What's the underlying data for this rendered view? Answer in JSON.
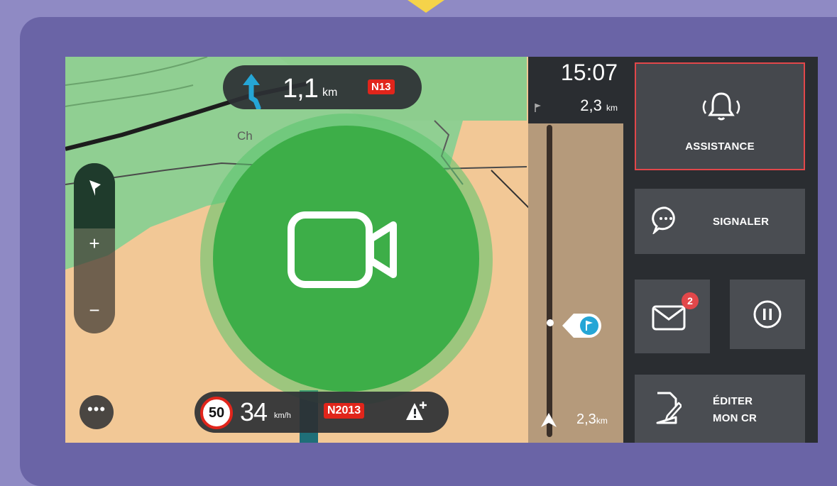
{
  "instruction": {
    "distance_value": "1,1",
    "distance_unit": "km",
    "road": "N13",
    "town": "Ch"
  },
  "arrival": {
    "time": "15:07",
    "remaining_value": "2,3",
    "remaining_unit": "km"
  },
  "route_bar": {
    "bottom_value": "2,3",
    "bottom_unit": "km"
  },
  "speed": {
    "limit": "50",
    "current": "34",
    "unit": "km/h",
    "road": "N2013"
  },
  "zoom": {
    "plus": "+",
    "minus": "−"
  },
  "more": {
    "label": "•••"
  },
  "side_panel": {
    "assistance": "ASSISTANCE",
    "signaler": "SIGNALER",
    "messages_badge": "2",
    "edit_line1": "ÉDITER",
    "edit_line2": "MON CR"
  },
  "colors": {
    "accent_green": "#3dae48",
    "alert_red": "#e1251b",
    "instruction_blue": "#25a6d6",
    "assistance_border": "#e2474a"
  },
  "icons": [
    "turn-left-arrow-icon",
    "camera-icon",
    "compass-icon",
    "bell-icon",
    "chat-bubble-icon",
    "envelope-icon",
    "pause-icon",
    "edit-document-icon",
    "warning-plus-icon",
    "destination-flag-icon",
    "position-arrow-icon"
  ]
}
